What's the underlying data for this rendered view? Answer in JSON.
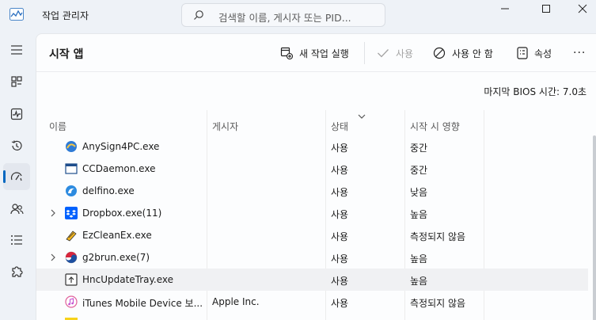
{
  "window": {
    "title": "작업 관리자",
    "search_placeholder": "검색할 이름, 게시자 또는 PID..."
  },
  "toolbar": {
    "page_title": "시작 앱",
    "new_task": "새 작업 실행",
    "enable": "사용",
    "disable": "사용 안 함",
    "properties": "속성",
    "more": "···"
  },
  "bios": "마지막 BIOS 시간:  7.0초",
  "columns": {
    "name": "이름",
    "publisher": "게시자",
    "status": "상태",
    "impact": "시작 시 영향"
  },
  "rows": [
    {
      "name": "AnySign4PC.exe",
      "publisher": "",
      "status": "사용",
      "impact": "중간",
      "icon": "anysign-icon",
      "expandable": false
    },
    {
      "name": "CCDaemon.exe",
      "publisher": "",
      "status": "사용",
      "impact": "중간",
      "icon": "window-app-icon",
      "expandable": false
    },
    {
      "name": "delfino.exe",
      "publisher": "",
      "status": "사용",
      "impact": "낮음",
      "icon": "delfino-icon",
      "expandable": false
    },
    {
      "name": "Dropbox.exe(11)",
      "publisher": "",
      "status": "사용",
      "impact": "높음",
      "icon": "dropbox-icon",
      "expandable": true
    },
    {
      "name": "EzCleanEx.exe",
      "publisher": "",
      "status": "사용",
      "impact": "측정되지 않음",
      "icon": "ezclean-icon",
      "expandable": false
    },
    {
      "name": "g2brun.exe(7)",
      "publisher": "",
      "status": "사용",
      "impact": "높음",
      "icon": "g2b-icon",
      "expandable": true
    },
    {
      "name": "HncUpdateTray.exe",
      "publisher": "",
      "status": "사용",
      "impact": "높음",
      "icon": "hnc-icon",
      "expandable": false
    },
    {
      "name": "iTunes Mobile Device 보...",
      "publisher": "Apple Inc.",
      "status": "사용",
      "impact": "측정되지 않음",
      "icon": "itunes-icon",
      "expandable": false
    }
  ],
  "colors": {
    "accent": "#0067c0",
    "dropbox": "#0061fe"
  }
}
